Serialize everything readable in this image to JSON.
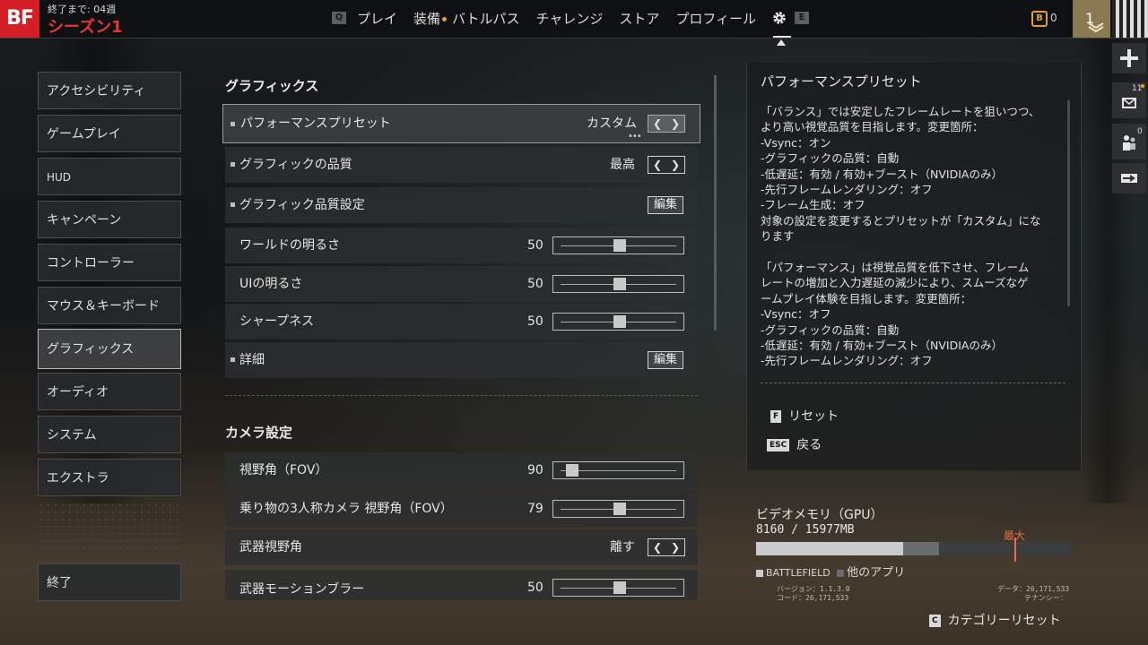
{
  "topbar": {
    "logo": "BF",
    "season_countdown": "終了まで: 04週",
    "season_name": "シーズン1",
    "nav": [
      {
        "key": "Q",
        "label": ""
      },
      {
        "label": "プレイ"
      },
      {
        "label": "装備",
        "dot": true
      },
      {
        "label": "バトルパス"
      },
      {
        "label": "チャレンジ"
      },
      {
        "label": "ストア"
      },
      {
        "label": "プロフィール"
      }
    ],
    "key_q": "Q",
    "key_e": "E",
    "nav_play": "プレイ",
    "nav_equip": "装備",
    "nav_battlepass": "バトルパス",
    "nav_challenge": "チャレンジ",
    "nav_store": "ストア",
    "nav_profile": "プロフィール",
    "currency_icon": "B",
    "currency_value": "0",
    "rank": "1"
  },
  "sidebar": {
    "items": [
      {
        "label": "アクセシビリティ"
      },
      {
        "label": "ゲームプレイ"
      },
      {
        "label": "HUD"
      },
      {
        "label": "キャンペーン"
      },
      {
        "label": "コントローラー"
      },
      {
        "label": "マウス＆キーボード"
      },
      {
        "label": "グラフィックス",
        "active": true
      },
      {
        "label": "オーディオ"
      },
      {
        "label": "システム"
      },
      {
        "label": "エクストラ"
      }
    ],
    "quit": "終了"
  },
  "graphics": {
    "title": "グラフィックス",
    "preset": {
      "label": "パフォーマンスプリセット",
      "value": "カスタム"
    },
    "quality": {
      "label": "グラフィックの品質",
      "value": "最高"
    },
    "quality_settings": {
      "label": "グラフィック品質設定",
      "button": "編集"
    },
    "world_brightness": {
      "label": "ワールドの明るさ",
      "value": "50",
      "fraction": 0.5
    },
    "ui_brightness": {
      "label": "UIの明るさ",
      "value": "50",
      "fraction": 0.5
    },
    "sharpness": {
      "label": "シャープネス",
      "value": "50",
      "fraction": 0.5
    },
    "details": {
      "label": "詳細",
      "button": "編集"
    }
  },
  "camera": {
    "title": "カメラ設定",
    "fov": {
      "label": "視野角（FOV）",
      "value": "90",
      "fraction": 0.1
    },
    "vehicle_fov": {
      "label": "乗り物の3人称カメラ 視野角（FOV）",
      "value": "79",
      "fraction": 0.5
    },
    "weapon_fov": {
      "label": "武器視野角",
      "value": "離す"
    },
    "weapon_blur": {
      "label": "武器モーションブラー",
      "value": "50",
      "fraction": 0.5
    }
  },
  "info_panel": {
    "title": "パフォーマンスプリセット",
    "lines": [
      "「バランス」では安定したフレームレートを狙いつつ、",
      "より高い視覚品質を目指します。変更箇所：",
      "-Vsync：オン",
      "-グラフィックの品質：自動",
      "-低遅延：有効 / 有効+ブースト（NVIDIAのみ）",
      "-先行フレームレンダリング：オフ",
      "-フレーム生成：オフ",
      "対象の設定を変更するとプリセットが「カスタム」にな",
      "ります",
      "",
      "「パフォーマンス」は視覚品質を低下させ、フレーム",
      "レートの増加と入力遅延の減少により、スムーズなゲ",
      "ームプレイ体験を目指します。変更箇所：",
      "-Vsync：オフ",
      "-グラフィックの品質：自動",
      "-低遅延：有効 / 有効+ブースト（NVIDIAのみ）",
      "-先行フレームレンダリング：オフ"
    ],
    "reset_key": "F",
    "reset_label": "リセット",
    "back_key": "ESC",
    "back_label": "戻る"
  },
  "side_icons": {
    "mail_count": "11",
    "friends_count": "0"
  },
  "vram": {
    "title": "ビデオメモリ（GPU）",
    "usage": "8160 / 15977MB",
    "battlefield_fraction": 0.466,
    "other_fraction": 0.114,
    "max_fraction": 0.82,
    "max_label": "最大",
    "legend_bf": "BATTLEFIELD",
    "legend_other": "他のアプリ"
  },
  "footer": {
    "version": "バージョン：1.1.3.0",
    "code": "コード：26,171,533",
    "data": "データ：26,171,533",
    "tenancy": "テナンシー：",
    "cat_reset_key": "C",
    "cat_reset_label": "カテゴリーリセット"
  }
}
